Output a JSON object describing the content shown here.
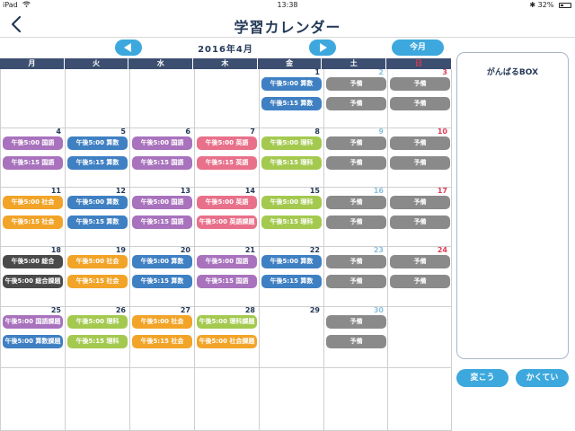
{
  "status": {
    "device": "iPad",
    "time": "13:38",
    "bluetooth": "✱",
    "battery_text": "32%",
    "battery_level": 0.32
  },
  "nav": {
    "title": "学習カレンダー",
    "back_icon": "chevron-left-icon"
  },
  "calendar": {
    "month_label": "2016年4月",
    "today_label": "今月",
    "prev_icon": "triangle-left-icon",
    "next_icon": "triangle-right-icon",
    "weekdays": [
      "月",
      "火",
      "水",
      "木",
      "金",
      "土",
      "日"
    ],
    "colors": {
      "kokugo": "#a872bd",
      "sansu": "#3f80c3",
      "eigo": "#e9708a",
      "rika": "#a4c94f",
      "shakai": "#f2a428",
      "sougou": "#4a4a4a",
      "yobi": "#8a8a8a",
      "header": "#3c4f71",
      "accent": "#3da8dd",
      "sunday": "#e23b55",
      "saturday": "#8ec1de"
    },
    "weeks": [
      [
        {
          "day": "",
          "events": []
        },
        {
          "day": "",
          "events": []
        },
        {
          "day": "",
          "events": []
        },
        {
          "day": "",
          "events": []
        },
        {
          "day": "1",
          "events": [
            {
              "text": "午後5:00 算数",
              "kind": "sansu"
            },
            {
              "text": "午後5:15 算数",
              "kind": "sansu"
            }
          ]
        },
        {
          "day": "2",
          "events": [
            {
              "text": "予備",
              "kind": "yobi"
            },
            {
              "text": "予備",
              "kind": "yobi"
            }
          ]
        },
        {
          "day": "3",
          "events": [
            {
              "text": "予備",
              "kind": "yobi"
            },
            {
              "text": "予備",
              "kind": "yobi"
            }
          ]
        }
      ],
      [
        {
          "day": "4",
          "events": [
            {
              "text": "午後5:00 国語",
              "kind": "kokugo"
            },
            {
              "text": "午後5:15 国語",
              "kind": "kokugo"
            }
          ]
        },
        {
          "day": "5",
          "events": [
            {
              "text": "午後5:00 算数",
              "kind": "sansu"
            },
            {
              "text": "午後5:15 算数",
              "kind": "sansu"
            }
          ]
        },
        {
          "day": "6",
          "events": [
            {
              "text": "午後5:00 国語",
              "kind": "kokugo"
            },
            {
              "text": "午後5:15 国語",
              "kind": "kokugo"
            }
          ]
        },
        {
          "day": "7",
          "events": [
            {
              "text": "午後5:00 英語",
              "kind": "eigo"
            },
            {
              "text": "午後5:15 英語",
              "kind": "eigo"
            }
          ]
        },
        {
          "day": "8",
          "events": [
            {
              "text": "午後5:00 理科",
              "kind": "rika"
            },
            {
              "text": "午後5:15 理科",
              "kind": "rika"
            }
          ]
        },
        {
          "day": "9",
          "events": [
            {
              "text": "予備",
              "kind": "yobi"
            },
            {
              "text": "予備",
              "kind": "yobi"
            }
          ]
        },
        {
          "day": "10",
          "events": [
            {
              "text": "予備",
              "kind": "yobi"
            },
            {
              "text": "予備",
              "kind": "yobi"
            }
          ]
        }
      ],
      [
        {
          "day": "11",
          "events": [
            {
              "text": "午後5:00 社会",
              "kind": "shakai"
            },
            {
              "text": "午後5:15 社会",
              "kind": "shakai"
            }
          ]
        },
        {
          "day": "12",
          "events": [
            {
              "text": "午後5:00 算数",
              "kind": "sansu"
            },
            {
              "text": "午後5:15 算数",
              "kind": "sansu"
            }
          ]
        },
        {
          "day": "13",
          "events": [
            {
              "text": "午後5:00 国語",
              "kind": "kokugo"
            },
            {
              "text": "午後5:15 国語",
              "kind": "kokugo"
            }
          ]
        },
        {
          "day": "14",
          "events": [
            {
              "text": "午後5:00 英語",
              "kind": "eigo"
            },
            {
              "text": "午後5:00 英語課題",
              "kind": "eigo"
            }
          ]
        },
        {
          "day": "15",
          "events": [
            {
              "text": "午後5:00 理科",
              "kind": "rika"
            },
            {
              "text": "午後5:15 理科",
              "kind": "rika"
            }
          ]
        },
        {
          "day": "16",
          "events": [
            {
              "text": "予備",
              "kind": "yobi"
            },
            {
              "text": "予備",
              "kind": "yobi"
            }
          ]
        },
        {
          "day": "17",
          "events": [
            {
              "text": "予備",
              "kind": "yobi"
            },
            {
              "text": "予備",
              "kind": "yobi"
            }
          ]
        }
      ],
      [
        {
          "day": "18",
          "events": [
            {
              "text": "午後5:00 総合",
              "kind": "sougou"
            },
            {
              "text": "午後5:00 総合課題",
              "kind": "sougou"
            }
          ]
        },
        {
          "day": "19",
          "events": [
            {
              "text": "午後5:00 社会",
              "kind": "shakai"
            },
            {
              "text": "午後5:15 社会",
              "kind": "shakai"
            }
          ]
        },
        {
          "day": "20",
          "events": [
            {
              "text": "午後5:00 算数",
              "kind": "sansu"
            },
            {
              "text": "午後5:15 算数",
              "kind": "sansu"
            }
          ]
        },
        {
          "day": "21",
          "events": [
            {
              "text": "午後5:00 国語",
              "kind": "kokugo"
            },
            {
              "text": "午後5:15 国語",
              "kind": "kokugo"
            }
          ]
        },
        {
          "day": "22",
          "events": [
            {
              "text": "午後5:00 算数",
              "kind": "sansu"
            },
            {
              "text": "午後5:15 算数",
              "kind": "sansu"
            }
          ]
        },
        {
          "day": "23",
          "events": [
            {
              "text": "予備",
              "kind": "yobi"
            },
            {
              "text": "予備",
              "kind": "yobi"
            }
          ]
        },
        {
          "day": "24",
          "events": [
            {
              "text": "予備",
              "kind": "yobi"
            },
            {
              "text": "予備",
              "kind": "yobi"
            }
          ]
        }
      ],
      [
        {
          "day": "25",
          "events": [
            {
              "text": "午後5:00 国語課題",
              "kind": "kokugo"
            },
            {
              "text": "午後5:00 算数課題",
              "kind": "sansu"
            }
          ]
        },
        {
          "day": "26",
          "events": [
            {
              "text": "午後5:00 理科",
              "kind": "rika"
            },
            {
              "text": "午後5:15 理科",
              "kind": "rika"
            }
          ]
        },
        {
          "day": "27",
          "events": [
            {
              "text": "午後5:00 社会",
              "kind": "shakai"
            },
            {
              "text": "午後5:15 社会",
              "kind": "shakai"
            }
          ]
        },
        {
          "day": "28",
          "events": [
            {
              "text": "午後5:00 理科課題",
              "kind": "rika"
            },
            {
              "text": "午後5:00 社会課題",
              "kind": "shakai"
            }
          ]
        },
        {
          "day": "29",
          "events": []
        },
        {
          "day": "30",
          "events": [
            {
              "text": "予備",
              "kind": "yobi"
            },
            {
              "text": "予備",
              "kind": "yobi"
            }
          ]
        },
        {
          "day": "",
          "events": []
        }
      ],
      [
        {
          "day": "",
          "events": []
        },
        {
          "day": "",
          "events": []
        },
        {
          "day": "",
          "events": []
        },
        {
          "day": "",
          "events": []
        },
        {
          "day": "",
          "events": []
        },
        {
          "day": "",
          "events": []
        },
        {
          "day": "",
          "events": []
        }
      ]
    ]
  },
  "side": {
    "box_title": "がんばるBOX",
    "change_label": "変こう",
    "hide_label": "かくてい"
  }
}
